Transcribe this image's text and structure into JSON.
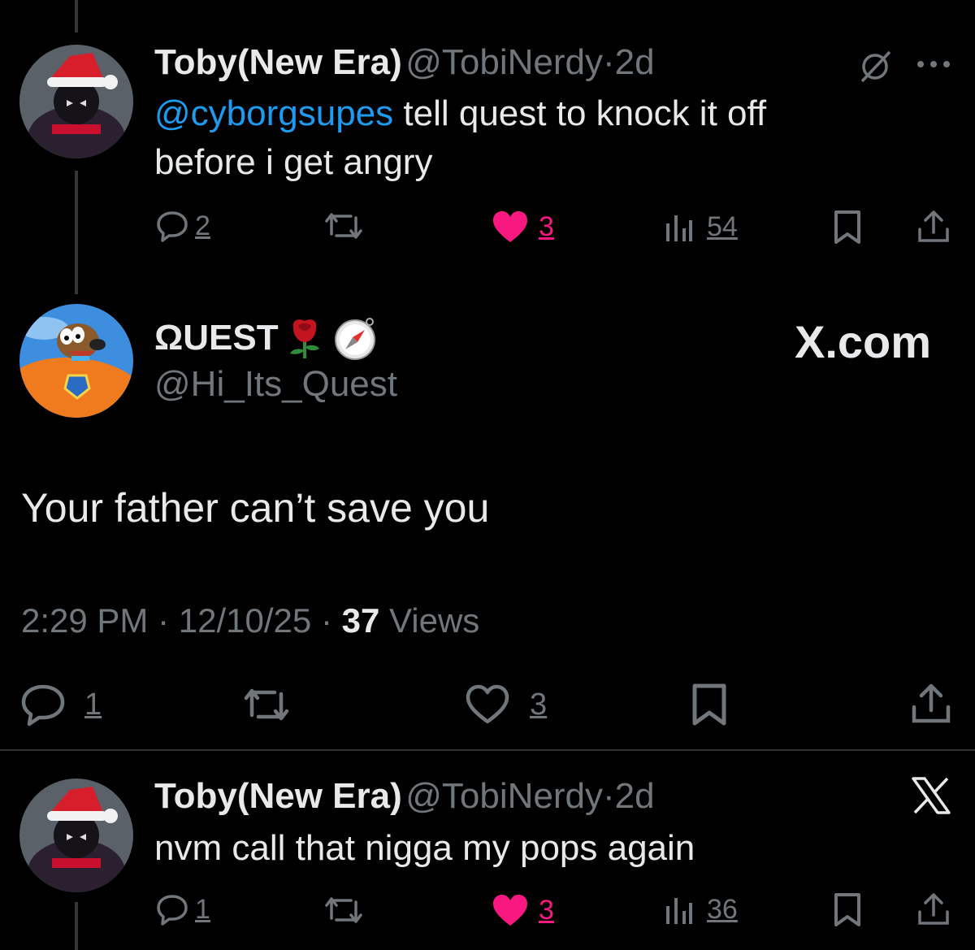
{
  "tweet1": {
    "name": "Toby(New Era)",
    "handle": "@TobiNerdy",
    "dot": "·",
    "time": "2d",
    "mention": "@cyborgsupes",
    "text_line1": " tell quest to knock it off",
    "text_line2": "before i get angry",
    "replies": "2",
    "likes": "3",
    "views": "54"
  },
  "main": {
    "name": "ΩUEST",
    "handle": "@Hi_Its_Quest",
    "watermark": "X.com",
    "text": "Your father can’t save you",
    "time": "2:29 PM",
    "sep1": "·",
    "date": "12/10/25",
    "sep2": "·",
    "views_count": "37",
    "views_label": "Views",
    "replies": "1",
    "likes": "3"
  },
  "tweet2": {
    "name": "Toby(New Era)",
    "handle": "@TobiNerdy",
    "dot": "·",
    "time": "2d",
    "text": "nvm call that nigga my pops again",
    "replies": "1",
    "likes": "3",
    "views": "36"
  },
  "colors": {
    "accent": "#1d9bf0",
    "like": "#f91880",
    "muted": "#71767b"
  }
}
